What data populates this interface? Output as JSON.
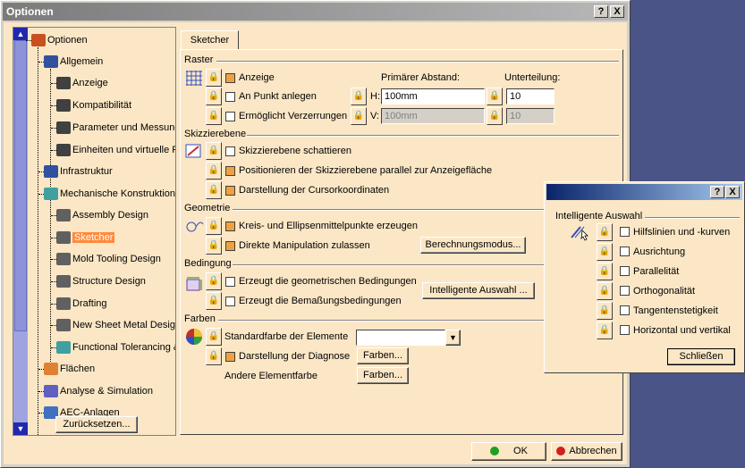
{
  "window": {
    "title": "Optionen",
    "help": "?",
    "close": "X"
  },
  "tree": {
    "items": [
      {
        "label": "Optionen",
        "color": "#c85020"
      },
      {
        "label": "Allgemein",
        "color": "#3050a0"
      },
      {
        "label": "Anzeige",
        "color": "#404040"
      },
      {
        "label": "Kompatibilität",
        "color": "#404040"
      },
      {
        "label": "Parameter und Messung",
        "color": "#404040"
      },
      {
        "label": "Einheiten und virtuelle R",
        "color": "#404040"
      },
      {
        "label": "Infrastruktur",
        "color": "#3050a0"
      },
      {
        "label": "Mechanische Konstruktion",
        "color": "#40a0a0"
      },
      {
        "label": "Assembly Design",
        "color": "#606060"
      },
      {
        "label": "Sketcher",
        "color": "#606060"
      },
      {
        "label": "Mold Tooling Design",
        "color": "#606060"
      },
      {
        "label": "Structure Design",
        "color": "#606060"
      },
      {
        "label": "Drafting",
        "color": "#606060"
      },
      {
        "label": "New Sheet Metal Design",
        "color": "#606060"
      },
      {
        "label": "Functional Tolerancing &",
        "color": "#40a0a0"
      },
      {
        "label": "Flächen",
        "color": "#e08030"
      },
      {
        "label": "Analyse & Simulation",
        "color": "#6060c0"
      },
      {
        "label": "AEC-Anlagen",
        "color": "#4070c0"
      }
    ],
    "reset": "Zurücksetzen..."
  },
  "tab": "Sketcher",
  "raster": {
    "title": "Raster",
    "show": "Anzeige",
    "snap": "An Punkt anlegen",
    "distort": "Ermöglicht Verzerrungen",
    "primary": "Primärer Abstand:",
    "subdiv": "Unterteilung:",
    "h": "H:",
    "v": "V:",
    "h_val": "100mm",
    "v_val": "100mm",
    "h_sub": "10",
    "v_sub": "10"
  },
  "plane": {
    "title": "Skizzierebene",
    "shade": "Skizzierebene schattieren",
    "position": "Positionieren der Skizzierebene parallel zur Anzeigefläche",
    "cursor": "Darstellung der Cursorkoordinaten"
  },
  "geometry": {
    "title": "Geometrie",
    "centers": "Kreis- und Ellipsenmittelpunkte erzeugen",
    "direct": "Direkte Manipulation zulassen",
    "calc": "Berechnungsmodus..."
  },
  "constraint": {
    "title": "Bedingung",
    "geom": "Erzeugt die geometrischen Bedingungen",
    "dim": "Erzeugt die Bemaßungsbedingungen",
    "smart": "Intelligente Auswahl ..."
  },
  "colors": {
    "title": "Farben",
    "standard": "Standardfarbe der Elemente",
    "diag": "Darstellung der Diagnose",
    "other": "Andere Elementfarbe",
    "btn1": "Farben...",
    "btn2": "Farben..."
  },
  "ok": "OK",
  "cancel": "Abbrechen",
  "smart_dialog": {
    "help": "?",
    "close": "X",
    "title": "Intelligente Auswahl",
    "items": [
      "Hilfslinien und -kurven",
      "Ausrichtung",
      "Parallelität",
      "Orthogonalität",
      "Tangentenstetigkeit",
      "Horizontal und vertikal"
    ],
    "close_btn": "Schließen"
  }
}
